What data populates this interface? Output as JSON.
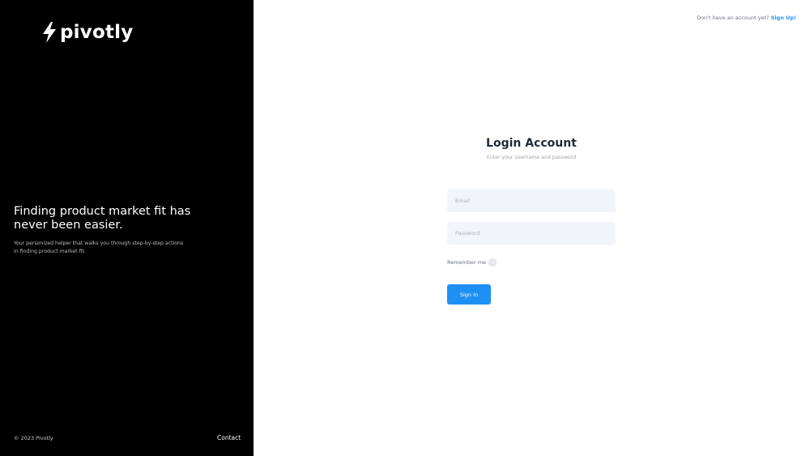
{
  "brand": {
    "name": "pivotly",
    "logo_icon": "lightning-bolt-icon"
  },
  "hero": {
    "headline": "Finding product market fit has never been easier.",
    "subtext": "Your personized helper that walks you through step-by-step actions in finding product market fit."
  },
  "footer": {
    "copyright": "© 2023 Pivotly",
    "contact_label": "Contact"
  },
  "header": {
    "signup_prompt": "Don't have an account yet?",
    "signup_link": "Sign Up!"
  },
  "login": {
    "title": "Login Account",
    "subtitle": "Enter your username and password",
    "email_placeholder": "Email",
    "email_value": "",
    "password_placeholder": "Password",
    "password_value": "",
    "remember_label": "Remember me",
    "remember_checked": false,
    "submit_label": "Sign In"
  },
  "colors": {
    "left_panel_bg": "#000000",
    "accent": "#1e90f3",
    "field_bg": "#f1f4f8",
    "page_bg": "#ffffff"
  }
}
